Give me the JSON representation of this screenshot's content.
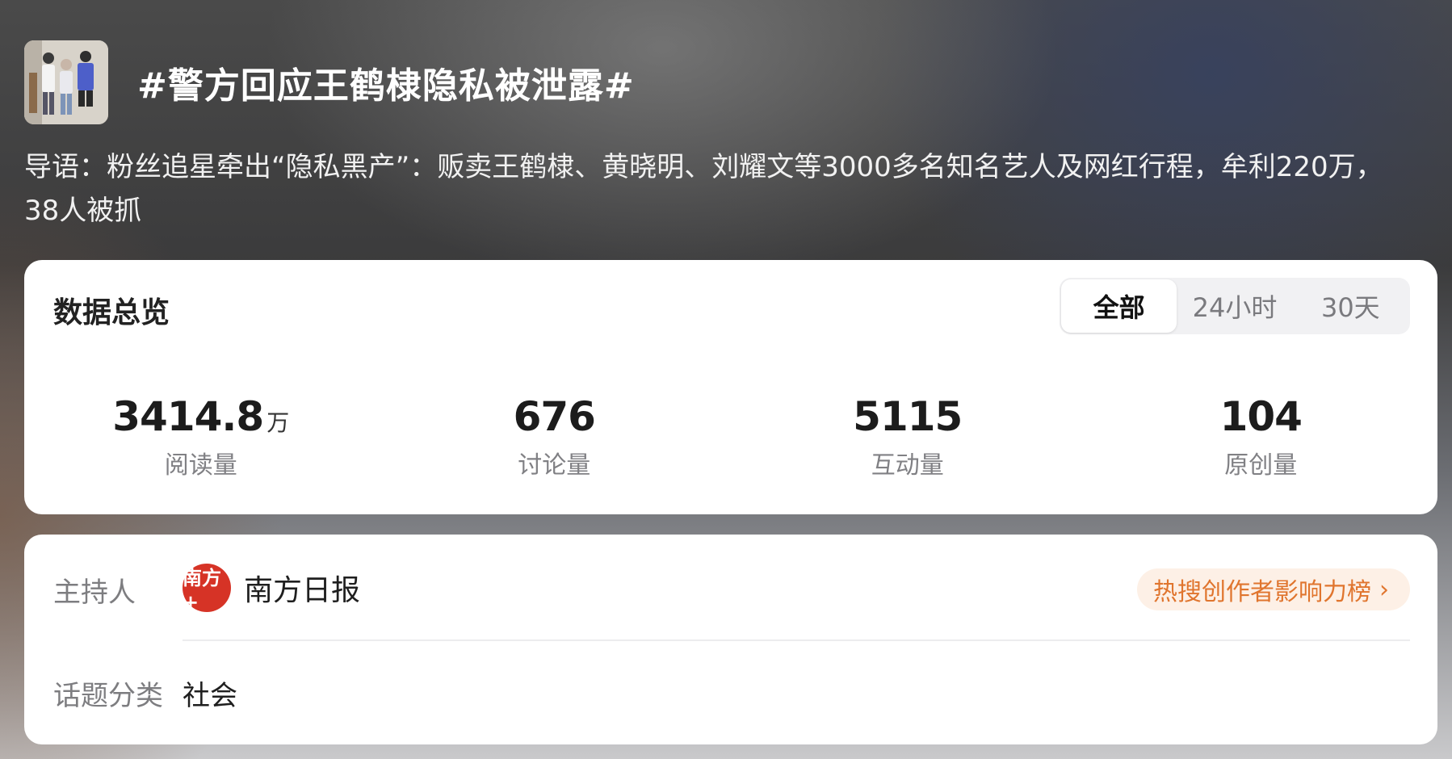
{
  "topic": {
    "title": "#警方回应王鹤棣隐私被泄露#",
    "intro": "导语：粉丝追星牵出“隐私黑产”：贩卖王鹤棣、黄晓明、刘耀文等3000多名知名艺人及网红行程，牟利220万，38人被抓"
  },
  "stats": {
    "title": "数据总览",
    "tabs": [
      "全部",
      "24小时",
      "30天"
    ],
    "active_tab": "全部",
    "metrics": [
      {
        "value": "3414.8",
        "unit": "万",
        "label": "阅读量"
      },
      {
        "value": "676",
        "unit": "",
        "label": "讨论量"
      },
      {
        "value": "5115",
        "unit": "",
        "label": "互动量"
      },
      {
        "value": "104",
        "unit": "",
        "label": "原创量"
      }
    ]
  },
  "info": {
    "host_label": "主持人",
    "host_name": "南方日报",
    "host_logo_text": "南方+",
    "rank_link": "热搜创作者影响力榜",
    "category_label": "话题分类",
    "category_value": "社会"
  },
  "colors": {
    "accent_orange": "#e0752e",
    "logo_red": "#d63326"
  },
  "icons": {
    "rank_chevron": "chevron-right-icon"
  }
}
